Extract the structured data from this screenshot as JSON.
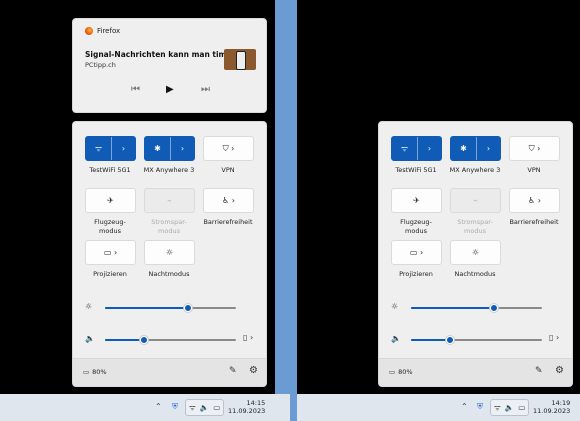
{
  "media": {
    "app": "Firefox",
    "title": "Signal-Nachrichten kann man timen...",
    "source": "PCtipp.ch",
    "prev": "⏮",
    "play": "▶",
    "next": "⏭"
  },
  "tiles": [
    {
      "id": "wifi",
      "icon": "ᯤ",
      "label": "TestWiFi 5G1",
      "on": true,
      "split": true
    },
    {
      "id": "bluetooth",
      "icon": "✱",
      "label": "MX Anywhere 3",
      "on": true,
      "split": true
    },
    {
      "id": "vpn",
      "icon": "⛉ ›",
      "label": "VPN",
      "on": false
    },
    {
      "id": "airplane",
      "icon": "✈",
      "label": "Flugzeug-\nmodus",
      "on": false
    },
    {
      "id": "battery-saver",
      "icon": "⌁",
      "label": "Stromspar-\nmodus",
      "on": false,
      "disabled": true
    },
    {
      "id": "accessibility",
      "icon": "♿ ›",
      "label": "Barrierefreiheit",
      "on": false
    },
    {
      "id": "project",
      "icon": "▭ ›",
      "label": "Projizieren",
      "on": false
    },
    {
      "id": "night-light",
      "icon": "☼",
      "label": "Nachtmodus",
      "on": false
    }
  ],
  "arrow": "›",
  "brightness": {
    "icon": "☼",
    "level": 0.63
  },
  "volume": {
    "icon": "🔈",
    "level": 0.3,
    "device_icon": "▯ ›"
  },
  "battery": "80%",
  "edit_icon": "✎",
  "settings_icon": "⚙",
  "taskbar": {
    "chevron": "⌃",
    "clock_left": {
      "time": "14:15",
      "date": "11.09.2023"
    },
    "clock_right": {
      "time": "14:19",
      "date": "11.09.2023"
    }
  }
}
